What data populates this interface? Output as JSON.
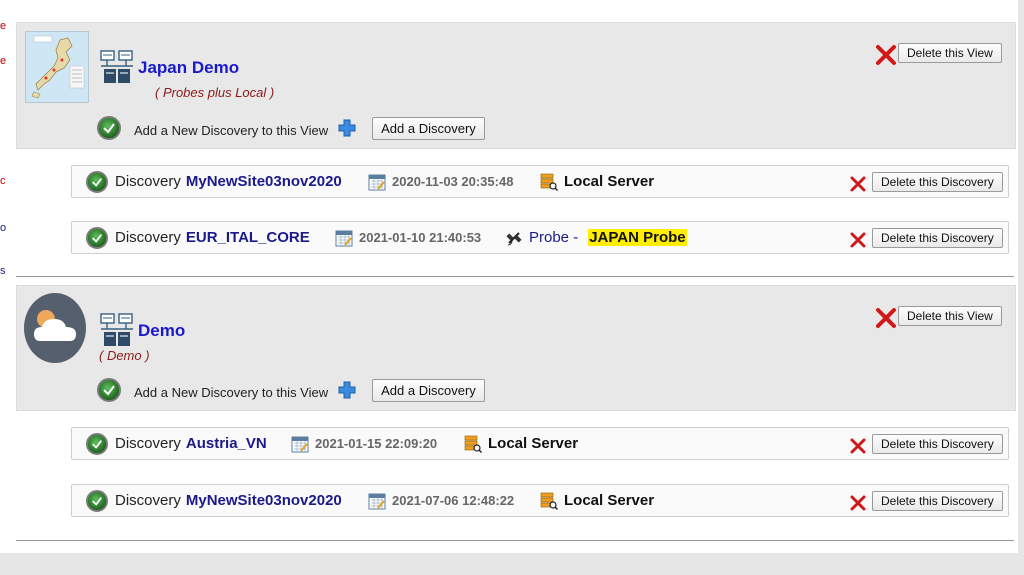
{
  "left_strip": {
    "fragments": [
      "e",
      "e",
      "c",
      "o",
      "s"
    ]
  },
  "views": [
    {
      "title": "Japan Demo",
      "subtitle": "( Probes plus Local )",
      "add_discovery_text": "Add a New Discovery to this View",
      "add_discovery_button": "Add a Discovery",
      "delete_view_button": "Delete this View",
      "thumbnail": "japan-map-icon",
      "discoveries": [
        {
          "label": "Discovery",
          "name": "MyNewSite03nov2020",
          "date": "2020-11-03 20:35:48",
          "server": "Local Server",
          "delete_button": "Delete this Discovery"
        },
        {
          "label": "Discovery",
          "name": "EUR_ITAL_CORE",
          "date": "2021-01-10 21:40:53",
          "probe_label": "Probe -",
          "probe_name": "JAPAN Probe",
          "delete_button": "Delete this Discovery"
        }
      ]
    },
    {
      "title": "Demo",
      "subtitle": "( Demo )",
      "add_discovery_text": "Add a New Discovery to this View",
      "add_discovery_button": "Add a Discovery",
      "delete_view_button": "Delete this View",
      "thumbnail": "cloud-weather-icon",
      "discoveries": [
        {
          "label": "Discovery",
          "name": "Austria_VN",
          "date": "2021-01-15 22:09:20",
          "server": "Local Server",
          "delete_button": "Delete this Discovery"
        },
        {
          "label": "Discovery",
          "name": "MyNewSite03nov2020",
          "date": "2021-07-06 12:48:22",
          "server": "Local Server",
          "delete_button": "Delete this Discovery"
        }
      ]
    }
  ],
  "colors": {
    "view_title": "#1a1acc",
    "discovery_name": "#1a1a8c",
    "subtitle": "#8b1a1a",
    "delete_red": "#d01818",
    "probe_highlight": "#ffee00"
  }
}
